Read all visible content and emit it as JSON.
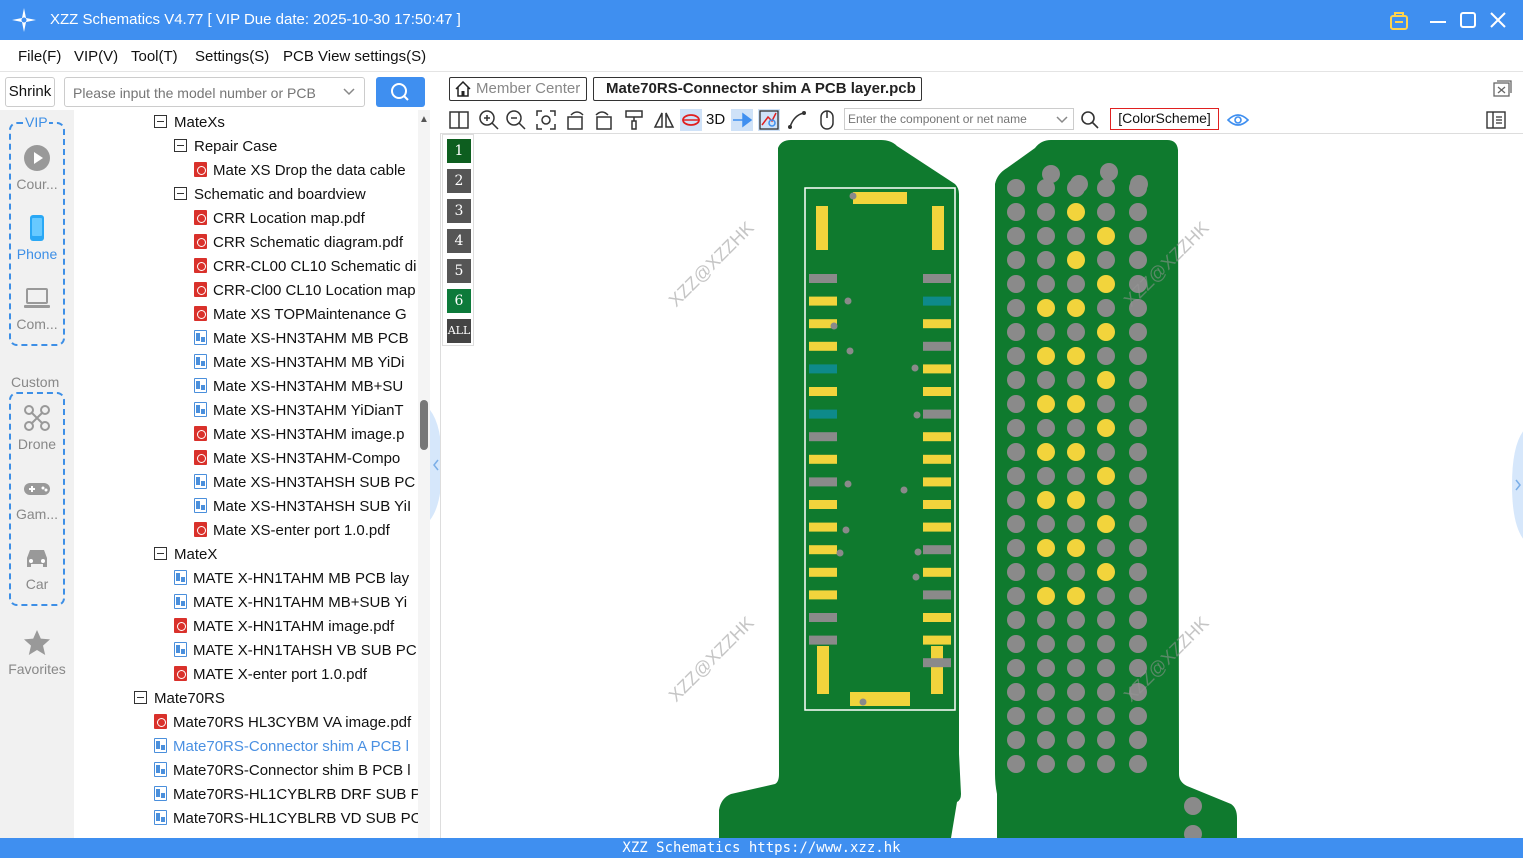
{
  "window": {
    "title": "XZZ Schematics V4.77 [ VIP Due date: 2025-10-30 17:50:47 ]"
  },
  "menu": [
    "File(F)",
    "VIP(V)",
    "Tool(T)",
    "Settings(S)",
    "PCB View settings(S)"
  ],
  "search": {
    "shrink_label": "Shrink",
    "placeholder": "Please input the model number or PCB"
  },
  "rail": {
    "vip_label": "VIP",
    "custom_label": "Custom",
    "items": [
      {
        "label": "Cour...",
        "icon": "play-icon"
      },
      {
        "label": "Phone",
        "icon": "phone-icon"
      },
      {
        "label": "Com...",
        "icon": "laptop-icon"
      },
      {
        "label": "Drone",
        "icon": "drone-icon"
      },
      {
        "label": "Gam...",
        "icon": "gamepad-icon"
      },
      {
        "label": "Car",
        "icon": "car-icon"
      },
      {
        "label": "Favorites",
        "icon": "star-icon"
      }
    ]
  },
  "tree": [
    {
      "label": "MateXs",
      "kind": "folder",
      "level": 2
    },
    {
      "label": "Repair Case",
      "kind": "folder",
      "level": 3
    },
    {
      "label": "Mate XS Drop the data cable",
      "kind": "pdf",
      "level": 4
    },
    {
      "label": "Schematic and boardview",
      "kind": "folder",
      "level": 3
    },
    {
      "label": "CRR Location map.pdf",
      "kind": "pdf",
      "level": 4
    },
    {
      "label": "CRR Schematic diagram.pdf",
      "kind": "pdf",
      "level": 4
    },
    {
      "label": "CRR-CL00 CL10 Schematic di",
      "kind": "pdf",
      "level": 4
    },
    {
      "label": "CRR-Cl00 CL10 Location map",
      "kind": "pdf",
      "level": 4
    },
    {
      "label": "Mate XS TOPMaintenance G",
      "kind": "pdf",
      "level": 4
    },
    {
      "label": "Mate XS-HN3TAHM MB PCB",
      "kind": "pcb",
      "level": 4
    },
    {
      "label": "Mate XS-HN3TAHM MB YiDi",
      "kind": "pcb",
      "level": 4
    },
    {
      "label": "Mate XS-HN3TAHM MB+SU",
      "kind": "pcb",
      "level": 4
    },
    {
      "label": "Mate XS-HN3TAHM YiDianT",
      "kind": "pcb",
      "level": 4
    },
    {
      "label": "Mate XS-HN3TAHM image.p",
      "kind": "pdf",
      "level": 4
    },
    {
      "label": "Mate XS-HN3TAHM-Compo",
      "kind": "pdf",
      "level": 4
    },
    {
      "label": "Mate XS-HN3TAHSH SUB PC",
      "kind": "pcb",
      "level": 4
    },
    {
      "label": "Mate XS-HN3TAHSH SUB YiI",
      "kind": "pcb",
      "level": 4
    },
    {
      "label": "Mate XS-enter port 1.0.pdf",
      "kind": "pdf",
      "level": 4
    },
    {
      "label": "MateX",
      "kind": "folder",
      "level": 2
    },
    {
      "label": "MATE X-HN1TAHM MB PCB lay",
      "kind": "pcb",
      "level": 3
    },
    {
      "label": "MATE X-HN1TAHM MB+SUB Yi",
      "kind": "pcb",
      "level": 3
    },
    {
      "label": "MATE X-HN1TAHM image.pdf",
      "kind": "pdf",
      "level": 3
    },
    {
      "label": "MATE X-HN1TAHSH VB SUB PC",
      "kind": "pcb",
      "level": 3
    },
    {
      "label": "MATE X-enter port 1.0.pdf",
      "kind": "pdf",
      "level": 3
    },
    {
      "label": "Mate70RS",
      "kind": "folder",
      "level": 1
    },
    {
      "label": "Mate70RS HL3CYBM VA image.pdf",
      "kind": "pdf",
      "level": 2
    },
    {
      "label": "Mate70RS-Connector shim A PCB l",
      "kind": "pcb",
      "level": 2,
      "selected": true
    },
    {
      "label": "Mate70RS-Connector shim B PCB l",
      "kind": "pcb",
      "level": 2
    },
    {
      "label": "Mate70RS-HL1CYBLRB DRF SUB PC",
      "kind": "pcb",
      "level": 2
    },
    {
      "label": "Mate70RS-HL1CYBLRB VD SUB PCI",
      "kind": "pcb",
      "level": 2
    }
  ],
  "tabs": {
    "member_center": "Member Center",
    "active_file": "Mate70RS-Connector shim A PCB layer.pcb"
  },
  "toolbar": {
    "three_d": "3D",
    "net_placeholder": "Enter the component or net name",
    "color_scheme": "[ColorScheme]"
  },
  "layers": [
    "1",
    "2",
    "3",
    "4",
    "5",
    "6",
    "ALL"
  ],
  "watermark": "XZZ@XZZHK",
  "status": "XZZ Schematics https://www.xzz.hk",
  "colors": {
    "accent": "#3f8ff0",
    "pcb_green": "#0f7a2e",
    "pad_yellow": "#f2d43c",
    "pad_gray": "#8a8a8a"
  }
}
